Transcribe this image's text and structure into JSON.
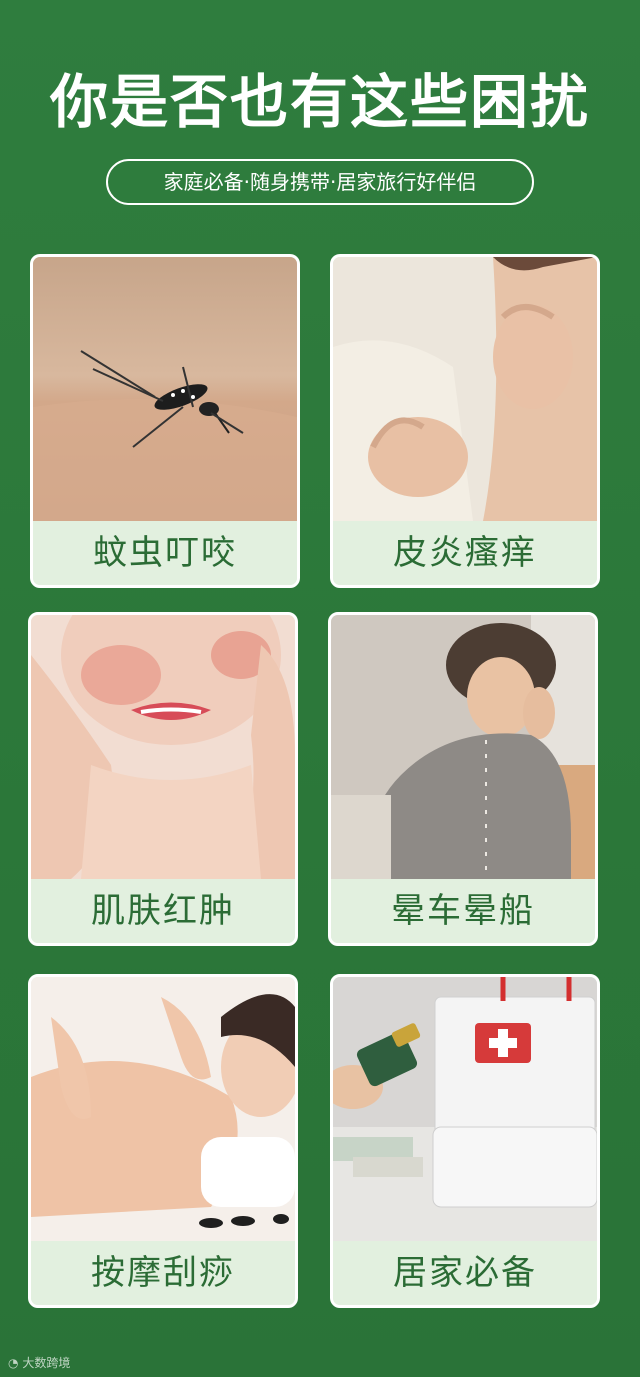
{
  "header": {
    "title": "你是否也有这些困扰",
    "subtitle": "家庭必备·随身携带·居家旅行好伴侣"
  },
  "cards": [
    {
      "label": "蚊虫叮咬",
      "icon": "mosquito-bite-photo"
    },
    {
      "label": "皮炎瘙痒",
      "icon": "itchy-skin-photo"
    },
    {
      "label": "肌肤红肿",
      "icon": "red-swollen-skin-photo"
    },
    {
      "label": "晕车晕船",
      "icon": "motion-sickness-photo"
    },
    {
      "label": "按摩刮痧",
      "icon": "massage-photo"
    },
    {
      "label": "居家必备",
      "icon": "first-aid-kit-photo"
    }
  ],
  "watermark": "大数跨境",
  "colors": {
    "background": "#2e7a3d",
    "label_background": "#e2f0df",
    "label_text": "#2b6c35"
  }
}
